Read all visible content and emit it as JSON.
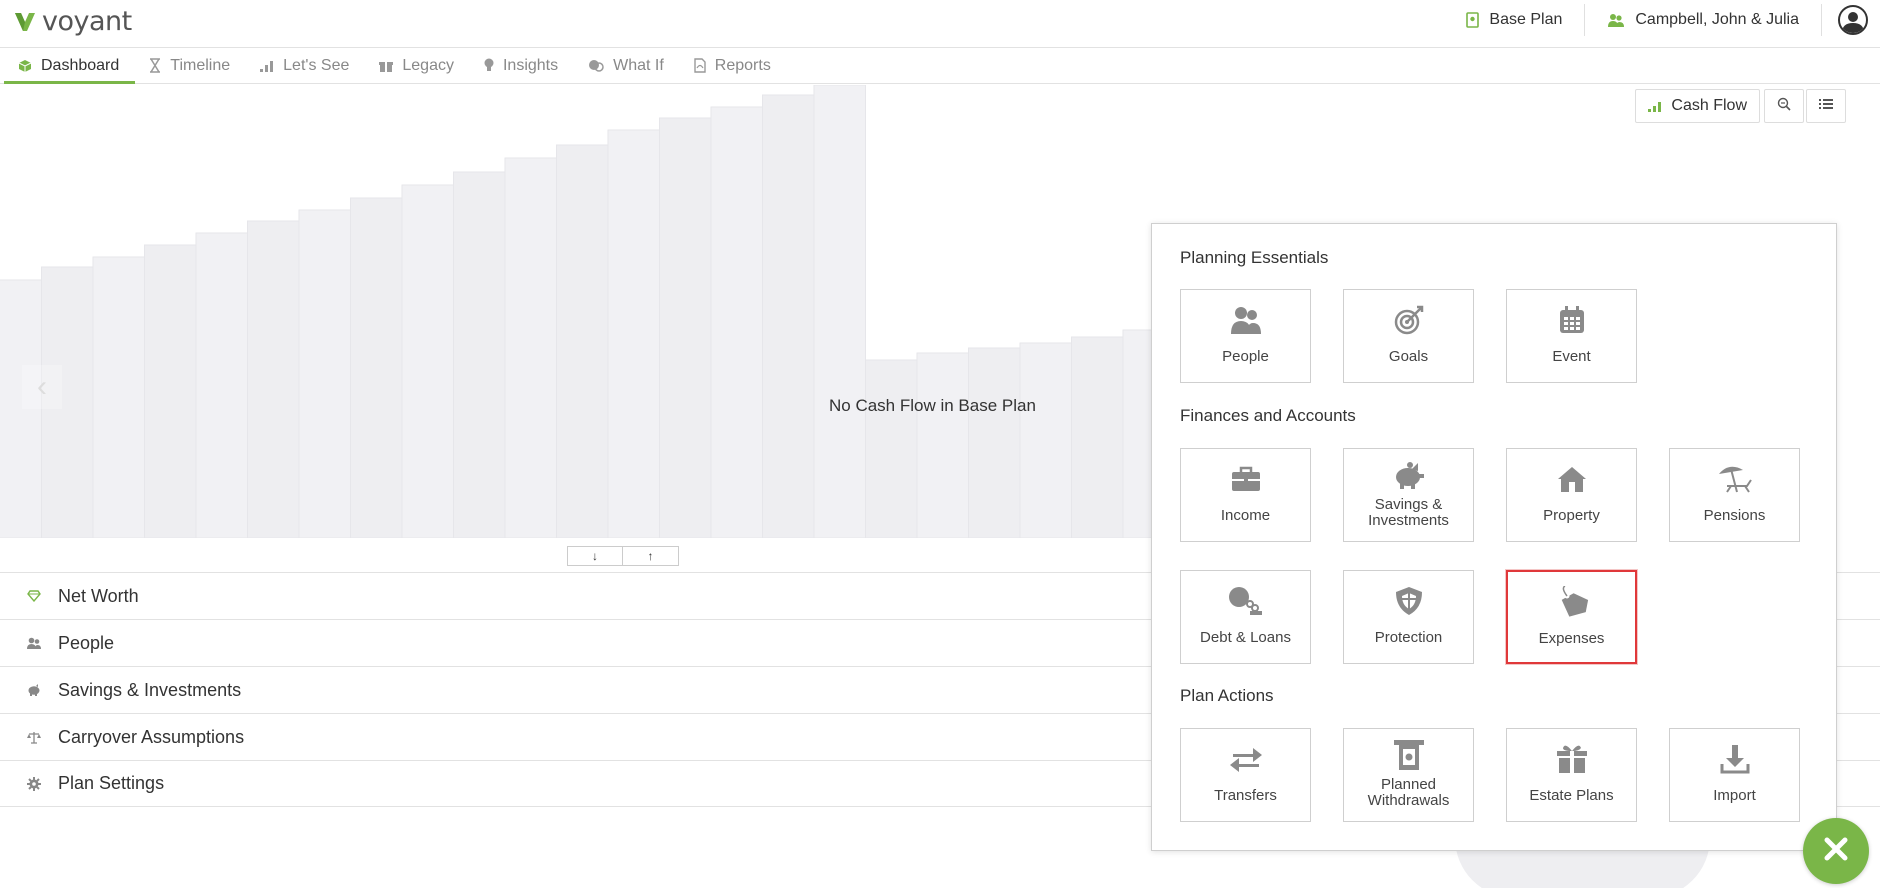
{
  "app": {
    "logo_text": "voyant"
  },
  "header": {
    "plan_label": "Base Plan",
    "client_label": "Campbell, John & Julia"
  },
  "tabs": [
    {
      "label": "Dashboard",
      "icon": "cube-icon",
      "active": true
    },
    {
      "label": "Timeline",
      "icon": "hourglass-icon"
    },
    {
      "label": "Let's See",
      "icon": "bar-chart-icon"
    },
    {
      "label": "Legacy",
      "icon": "gift-icon"
    },
    {
      "label": "Insights",
      "icon": "lightbulb-icon"
    },
    {
      "label": "What If",
      "icon": "compare-icon"
    },
    {
      "label": "Reports",
      "icon": "pdf-icon"
    }
  ],
  "chart": {
    "empty_message": "No Cash Flow in Base Plan",
    "cashflow_button": "Cash Flow"
  },
  "sections": [
    {
      "label": "Net Worth",
      "icon": "diamond-icon"
    },
    {
      "label": "People",
      "icon": "people-icon"
    },
    {
      "label": "Savings & Investments",
      "icon": "piggy-bank-icon"
    },
    {
      "label": "Carryover Assumptions",
      "icon": "scales-icon"
    },
    {
      "label": "Plan Settings",
      "icon": "gear-icon"
    }
  ],
  "panel": {
    "groups": [
      {
        "title": "Planning Essentials",
        "items": [
          {
            "label": "People",
            "icon": "people-icon"
          },
          {
            "label": "Goals",
            "icon": "target-icon"
          },
          {
            "label": "Event",
            "icon": "calendar-icon"
          }
        ]
      },
      {
        "title": "Finances and Accounts",
        "items": [
          {
            "label": "Income",
            "icon": "briefcase-icon"
          },
          {
            "label": "Savings & Investments",
            "icon": "piggy-bank-icon"
          },
          {
            "label": "Property",
            "icon": "house-icon"
          },
          {
            "label": "Pensions",
            "icon": "beach-icon"
          },
          {
            "label": "Debt & Loans",
            "icon": "ball-chain-icon"
          },
          {
            "label": "Protection",
            "icon": "shield-icon"
          },
          {
            "label": "Expenses",
            "icon": "price-tag-icon",
            "highlighted": true
          }
        ]
      },
      {
        "title": "Plan Actions",
        "items": [
          {
            "label": "Transfers",
            "icon": "transfer-arrows-icon"
          },
          {
            "label": "Planned Withdrawals",
            "icon": "withdrawal-icon"
          },
          {
            "label": "Estate Plans",
            "icon": "gift-icon"
          },
          {
            "label": "Import",
            "icon": "download-icon"
          }
        ]
      }
    ]
  },
  "colors": {
    "brand_green": "#7ab648",
    "highlight_red": "#e0383a",
    "icon_gray": "#8a8a8a"
  }
}
